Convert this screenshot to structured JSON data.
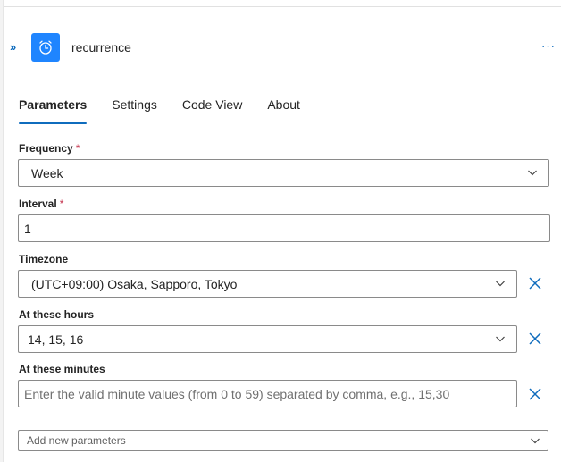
{
  "header": {
    "title": "recurrence",
    "collapse_glyph": "»",
    "more_glyph": "···",
    "trigger_icon": "alarm-clock-icon"
  },
  "tabs": [
    {
      "label": "Parameters",
      "active": true
    },
    {
      "label": "Settings",
      "active": false
    },
    {
      "label": "Code View",
      "active": false
    },
    {
      "label": "About",
      "active": false
    }
  ],
  "form": {
    "frequency": {
      "label": "Frequency",
      "required_mark": "*",
      "value": "Week"
    },
    "interval": {
      "label": "Interval",
      "required_mark": "*",
      "value": "1"
    },
    "timezone": {
      "label": "Timezone",
      "value": "(UTC+09:00) Osaka, Sapporo, Tokyo"
    },
    "hours": {
      "label": "At these hours",
      "value": "14, 15, 16"
    },
    "minutes": {
      "label": "At these minutes",
      "placeholder": "Enter the valid minute values (from 0 to 59) separated by comma, e.g., 15,30"
    },
    "add_params": {
      "placeholder": "Add new parameters"
    }
  },
  "colors": {
    "accent": "#0f6cbd",
    "trigger_bg": "#1f85ff",
    "required": "#c4314b"
  }
}
